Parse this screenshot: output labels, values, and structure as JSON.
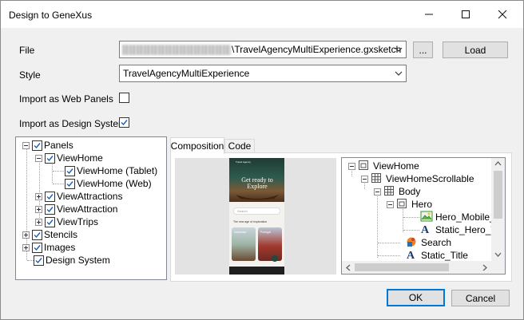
{
  "window": {
    "title": "Design to GeneXus"
  },
  "form": {
    "file_label": "File",
    "file_value": "\\TravelAgencyMultiExperience.gxsketch",
    "browse_label": "...",
    "load_label": "Load",
    "style_label": "Style",
    "style_value": "TravelAgencyMultiExperience",
    "import_web_panels_label": "Import as Web Panels",
    "import_web_panels_checked": false,
    "import_design_system_label": "Import as Design System",
    "import_design_system_checked": true
  },
  "left_tree": [
    {
      "label": "Panels"
    },
    {
      "label": "ViewHome"
    },
    {
      "label": "ViewHome (Tablet)"
    },
    {
      "label": "ViewHome (Web)"
    },
    {
      "label": "ViewAttractions"
    },
    {
      "label": "ViewAttraction"
    },
    {
      "label": "ViewTrips"
    },
    {
      "label": "Stencils"
    },
    {
      "label": "Images"
    },
    {
      "label": "Design System"
    }
  ],
  "tabs": [
    {
      "label": "Composition",
      "active": true
    },
    {
      "label": "Code",
      "active": false
    }
  ],
  "preview": {
    "header_text": "Travel Agency",
    "hero_title": "Get ready to Explore",
    "search_placeholder": "Search",
    "section_title": "The new age of exploration",
    "card1": "Indonesia",
    "card2": "Portugal"
  },
  "right_tree": [
    {
      "label": "ViewHome",
      "icon": "panel-icon"
    },
    {
      "label": "ViewHomeScrollable",
      "icon": "table-icon"
    },
    {
      "label": "Body",
      "icon": "table-icon"
    },
    {
      "label": "Hero",
      "icon": "panel-icon"
    },
    {
      "label": "Hero_Mobile_",
      "icon": "image-icon"
    },
    {
      "label": "Static_Hero_T",
      "icon": "text-icon"
    },
    {
      "label": "Search",
      "icon": "component-icon"
    },
    {
      "label": "Static_Title",
      "icon": "text-icon"
    }
  ],
  "footer": {
    "ok_label": "OK",
    "cancel_label": "Cancel"
  },
  "colors": {
    "accent": "#0078d7",
    "check": "#1a5fb4"
  }
}
